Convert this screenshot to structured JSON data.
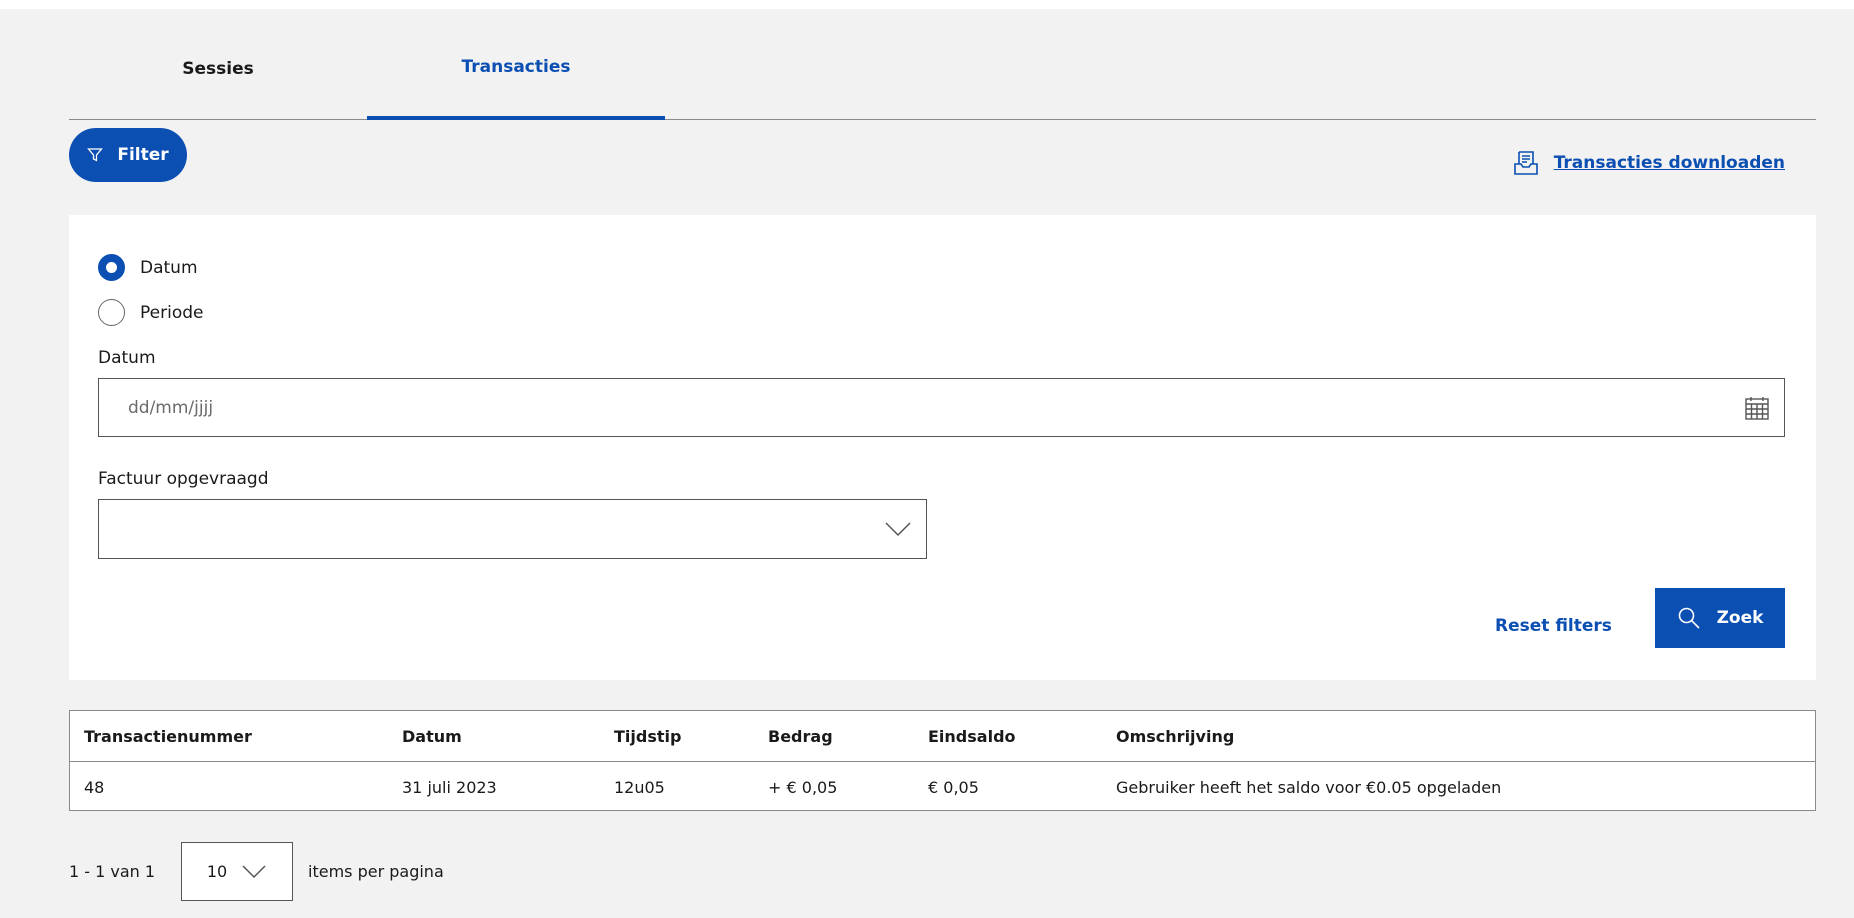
{
  "tabs": [
    {
      "label": "Sessies",
      "active": false
    },
    {
      "label": "Transacties",
      "active": true
    }
  ],
  "toolbar": {
    "filter_label": "Filter",
    "download_label": "Transacties downloaden"
  },
  "filters": {
    "radios": [
      {
        "label": "Datum",
        "checked": true
      },
      {
        "label": "Periode",
        "checked": false
      }
    ],
    "date_label": "Datum",
    "date_placeholder": "dd/mm/jjjj",
    "invoice_label": "Factuur opgevraagd",
    "invoice_value": "",
    "reset_label": "Reset filters",
    "search_label": "Zoek"
  },
  "table": {
    "columns": [
      "Transactienummer",
      "Datum",
      "Tijdstip",
      "Bedrag",
      "Eindsaldo",
      "Omschrijving"
    ],
    "rows": [
      [
        "48",
        "31 juli 2023",
        "12u05",
        "+ € 0,05",
        "€ 0,05",
        "Gebruiker heeft het saldo voor €0.05 opgeladen"
      ]
    ]
  },
  "pagination": {
    "range": "1 - 1 van 1",
    "page_size": "10",
    "per_page_label": "items per pagina"
  },
  "colors": {
    "accent": "#0b4fb3",
    "page_bg": "#f2f2f2",
    "panel_bg": "#ffffff"
  },
  "icons": [
    "filter-icon",
    "document-download-icon",
    "calendar-icon",
    "chevron-down-icon",
    "search-icon"
  ]
}
